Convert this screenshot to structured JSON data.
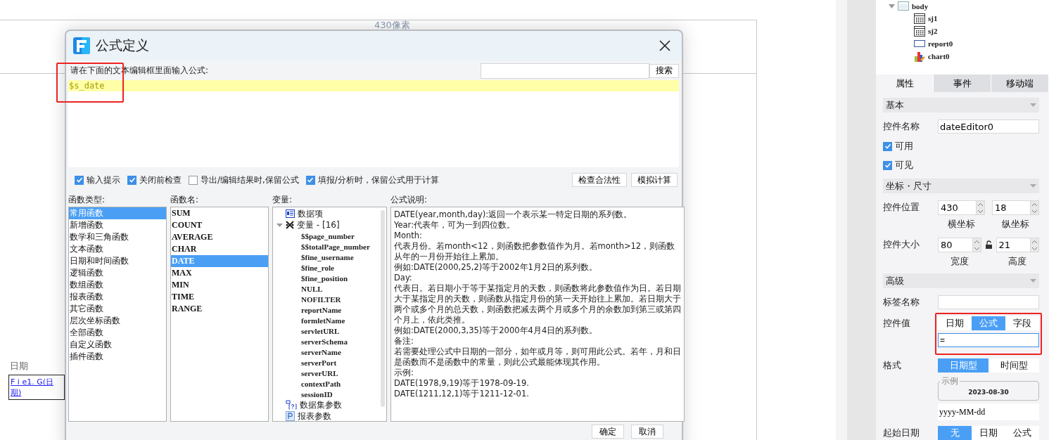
{
  "canvas": {
    "ruler_label": "430像素",
    "widget": {
      "header": "日期",
      "lines": [
        "F i e1. G(日",
        "期)"
      ]
    }
  },
  "dialog": {
    "title": "公式定义",
    "prompt": "请在下面的文本编辑框里面输入公式:",
    "search_button": "搜索",
    "formula_lines": [
      "$s_date"
    ],
    "options": [
      {
        "label": "输入提示",
        "checked": true
      },
      {
        "label": "关闭前检查",
        "checked": true
      },
      {
        "label": "导出/编辑结果时,保留公式",
        "checked": false
      },
      {
        "label": "填报/分析时，保留公式用于计算",
        "checked": true
      }
    ],
    "actions": [
      "检查合法性",
      "模拟计算"
    ],
    "function_types": {
      "header": "函数类型:",
      "items": [
        {
          "label": "常用函数",
          "selected": true
        },
        {
          "label": "新增函数",
          "selected": false
        },
        {
          "label": "数学和三角函数",
          "selected": false
        },
        {
          "label": "文本函数",
          "selected": false
        },
        {
          "label": "日期和时间函数",
          "selected": false
        },
        {
          "label": "逻辑函数",
          "selected": false
        },
        {
          "label": "数组函数",
          "selected": false
        },
        {
          "label": "报表函数",
          "selected": false
        },
        {
          "label": "其它函数",
          "selected": false
        },
        {
          "label": "层次坐标函数",
          "selected": false
        },
        {
          "label": "全部函数",
          "selected": false
        },
        {
          "label": "自定义函数",
          "selected": false
        },
        {
          "label": "插件函数",
          "selected": false
        }
      ]
    },
    "function_names": {
      "header": "函数名:",
      "items": [
        {
          "label": "SUM",
          "selected": false
        },
        {
          "label": "COUNT",
          "selected": false
        },
        {
          "label": "AVERAGE",
          "selected": false
        },
        {
          "label": "CHAR",
          "selected": false
        },
        {
          "label": "DATE",
          "selected": true
        },
        {
          "label": "MAX",
          "selected": false
        },
        {
          "label": "MIN",
          "selected": false
        },
        {
          "label": "TIME",
          "selected": false
        },
        {
          "label": "RANGE",
          "selected": false
        }
      ]
    },
    "variables": {
      "header": "变量:",
      "items": [
        {
          "label": "数据项",
          "kind": "data"
        },
        {
          "label": "变量 - [16]",
          "kind": "variable",
          "expanded": true,
          "children": [
            {
              "label": "$$page_number"
            },
            {
              "label": "$$totalPage_number"
            },
            {
              "label": "$fine_username"
            },
            {
              "label": "$fine_role"
            },
            {
              "label": "$fine_position"
            },
            {
              "label": "NULL"
            },
            {
              "label": "NOFILTER"
            },
            {
              "label": "reportName"
            },
            {
              "label": "formletName"
            },
            {
              "label": "servletURL"
            },
            {
              "label": "serverSchema"
            },
            {
              "label": "serverName"
            },
            {
              "label": "serverPort"
            },
            {
              "label": "serverURL"
            },
            {
              "label": "contextPath"
            },
            {
              "label": "sessionID"
            }
          ]
        },
        {
          "label": "数据集参数",
          "kind": "dataset"
        },
        {
          "label": "报表参数",
          "kind": "param"
        }
      ]
    },
    "description": {
      "header": "公式说明:",
      "paragraphs": [
        "DATE(year,month,day):返回一个表示某一特定日期的系列数。",
        "Year:代表年，可为一到四位数。",
        "Month:",
        "代表月份。若month<12，则函数把参数值作为月。若month>12，则函数从年的一月份开始往上累加。",
        "例如:DATE(2000,25,2)等于2002年1月2日的系列数。",
        "Day:",
        "代表日。若日期小于等于某指定月的天数，则函数将此参数值作为日。若日期大于某指定月的天数，则函数从指定月份的第一天开始往上累加。若日期大于两个或多个月的总天数，则函数把减去两个月或多个月的余数加到第三或第四个月上，依此类推。",
        "例如:DATE(2000,3,35)等于2000年4月4日的系列数。",
        "备注:",
        "若需要处理公式中日期的一部分，如年或月等，则可用此公式。若年，月和日是函数而不是函数中的常量，则此公式最能体现其作用。",
        "示例:",
        "DATE(1978,9,19)等于1978-09-19.",
        "DATE(1211,12,1)等于1211-12-01."
      ]
    },
    "buttons": [
      "确定",
      "取消"
    ]
  },
  "panel": {
    "tree": {
      "label": "body",
      "expanded": true,
      "children": [
        {
          "label": "sj1",
          "kind": "dataset"
        },
        {
          "label": "sj2",
          "kind": "dataset"
        },
        {
          "label": "report0",
          "kind": "report"
        },
        {
          "label": "chart0",
          "kind": "chart"
        }
      ]
    },
    "tabs": [
      {
        "label": "属性",
        "selected": true
      },
      {
        "label": "事件",
        "selected": false
      },
      {
        "label": "移动端",
        "selected": false
      }
    ],
    "basic": {
      "title": "基本",
      "name_label": "控件名称",
      "name_value": "dateEditor0",
      "checks": [
        {
          "label": "可用",
          "checked": true
        },
        {
          "label": "可见",
          "checked": true
        }
      ]
    },
    "geometry": {
      "title": "坐标・尺寸",
      "rows": [
        {
          "label": "控件位置",
          "kind": "position",
          "fields": [
            {
              "value": "430",
              "caption": "横坐标"
            },
            {
              "value": "18",
              "caption": "纵坐标"
            }
          ]
        },
        {
          "label": "控件大小",
          "kind": "size",
          "fields": [
            {
              "value": "80",
              "caption": "宽度"
            },
            {
              "value": "21",
              "caption": "高度"
            }
          ]
        }
      ]
    },
    "advanced": {
      "title": "高级",
      "tag_label": "标签名称",
      "value_label": "控件值",
      "value_modes": [
        {
          "label": "日期",
          "selected": false
        },
        {
          "label": "公式",
          "selected": true
        },
        {
          "label": "字段",
          "selected": false
        }
      ],
      "value_input": "=",
      "format_label": "格式",
      "format_modes": [
        {
          "label": "日期型",
          "selected": true
        },
        {
          "label": "时间型",
          "selected": false
        }
      ],
      "example_legend": "示例",
      "example_value": "2023-08-30",
      "format_pattern": "yyyy-MM-dd",
      "start_label": "起始日期",
      "start_modes": [
        {
          "label": "无",
          "selected": true
        },
        {
          "label": "日期",
          "selected": false
        },
        {
          "label": "公式",
          "selected": false
        }
      ]
    }
  }
}
